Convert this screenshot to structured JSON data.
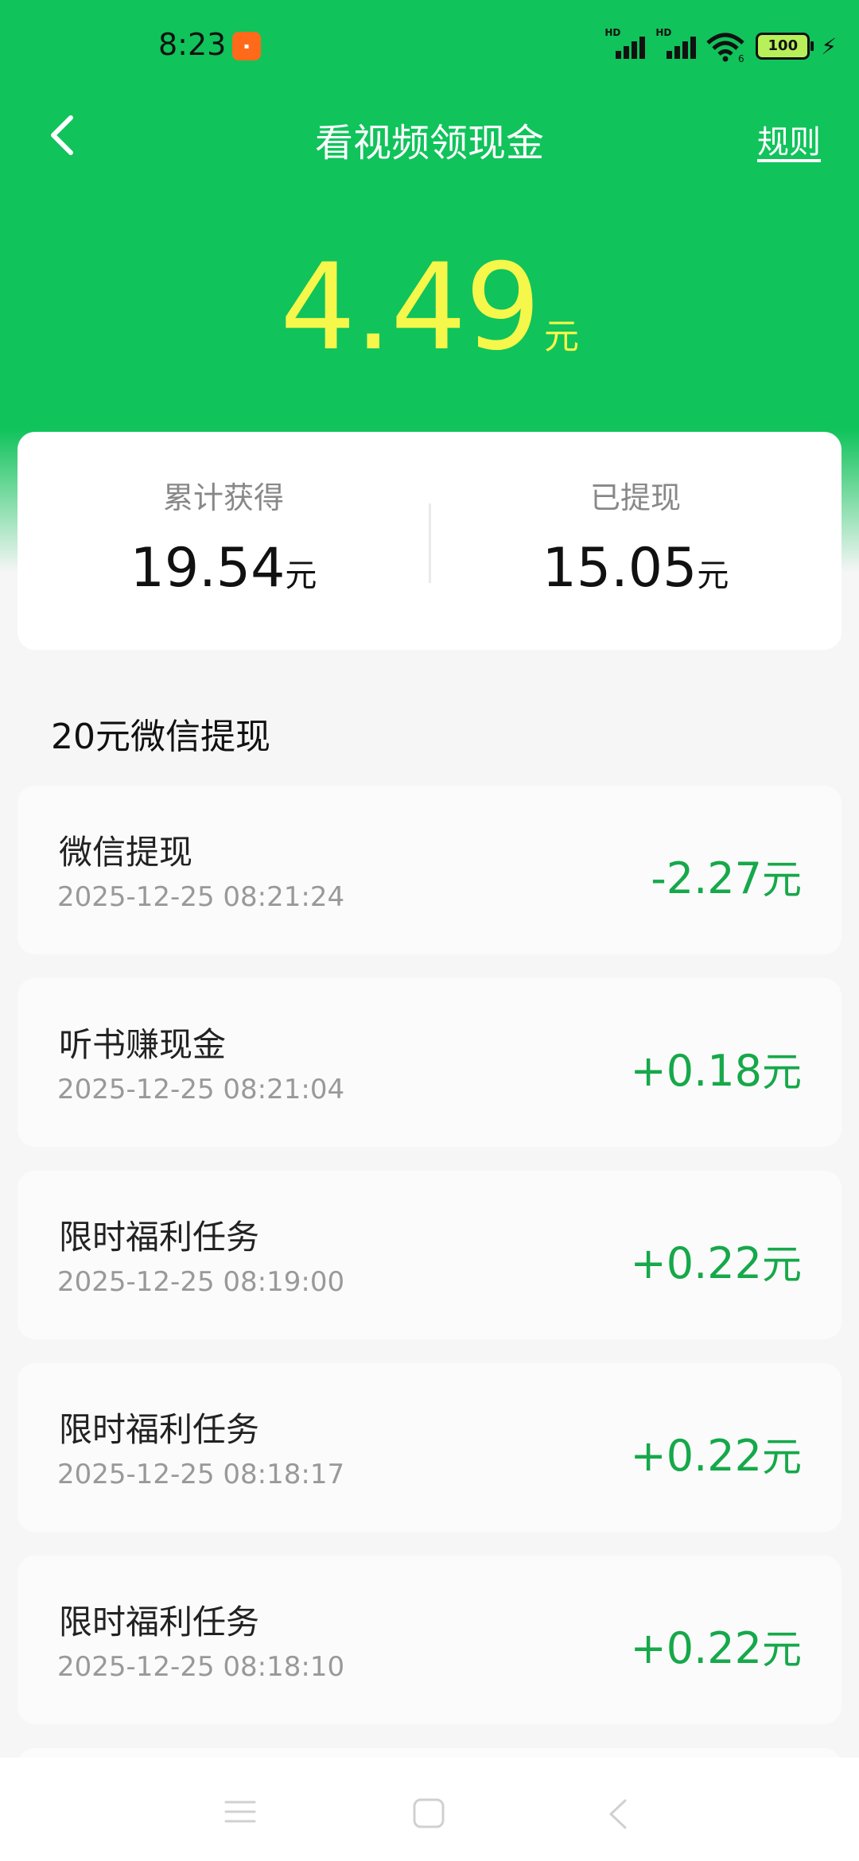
{
  "status_bar": {
    "time": "8:23",
    "signal_labels": [
      "HD",
      "HD"
    ],
    "wifi_badge": "6",
    "battery": "100"
  },
  "header": {
    "title": "看视频领现金",
    "rules": "规则"
  },
  "balance": {
    "amount": "4.49",
    "unit": "元"
  },
  "summary": {
    "earned_label": "累计获得",
    "earned_value": "19.54",
    "earned_unit": "元",
    "withdrawn_label": "已提现",
    "withdrawn_value": "15.05",
    "withdrawn_unit": "元"
  },
  "section": {
    "title": "20元微信提现"
  },
  "records": [
    {
      "title": "微信提现",
      "time": "2025-12-25 08:21:24",
      "amount": "-2.27",
      "unit": "元"
    },
    {
      "title": "听书赚现金",
      "time": "2025-12-25 08:21:04",
      "amount": "+0.18",
      "unit": "元"
    },
    {
      "title": "限时福利任务",
      "time": "2025-12-25 08:19:00",
      "amount": "+0.22",
      "unit": "元"
    },
    {
      "title": "限时福利任务",
      "time": "2025-12-25 08:18:17",
      "amount": "+0.22",
      "unit": "元"
    },
    {
      "title": "限时福利任务",
      "time": "2025-12-25 08:18:10",
      "amount": "+0.22",
      "unit": "元"
    }
  ],
  "colors": {
    "brand_green": "#10c35b",
    "balance_yellow": "#f5f74a",
    "amount_green": "#16a84a"
  }
}
